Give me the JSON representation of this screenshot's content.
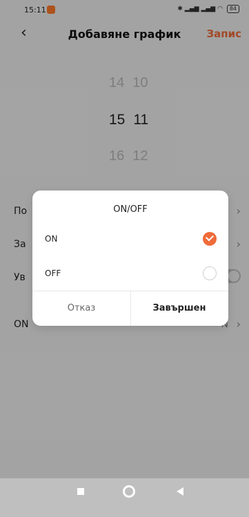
{
  "status_bar": {
    "time": "15:11",
    "battery": "84"
  },
  "header": {
    "title": "Добавяне график",
    "save_label": "Запис"
  },
  "picker": {
    "rows": [
      {
        "hour": "14",
        "minute": "10"
      },
      {
        "hour": "15",
        "minute": "11"
      },
      {
        "hour": "16",
        "minute": "12"
      }
    ]
  },
  "settings": {
    "rows": [
      {
        "label": "По",
        "value": "к"
      },
      {
        "label": "За",
        "value": ""
      },
      {
        "label": "Ув",
        "value": ""
      },
      {
        "label": "ON",
        "value": "N"
      }
    ]
  },
  "dialog": {
    "title": "ON/OFF",
    "options": [
      {
        "label": "ON",
        "selected": true
      },
      {
        "label": "OFF",
        "selected": false
      }
    ],
    "cancel_label": "Отказ",
    "done_label": "Завършен"
  },
  "colors": {
    "accent": "#ef6b3a"
  }
}
